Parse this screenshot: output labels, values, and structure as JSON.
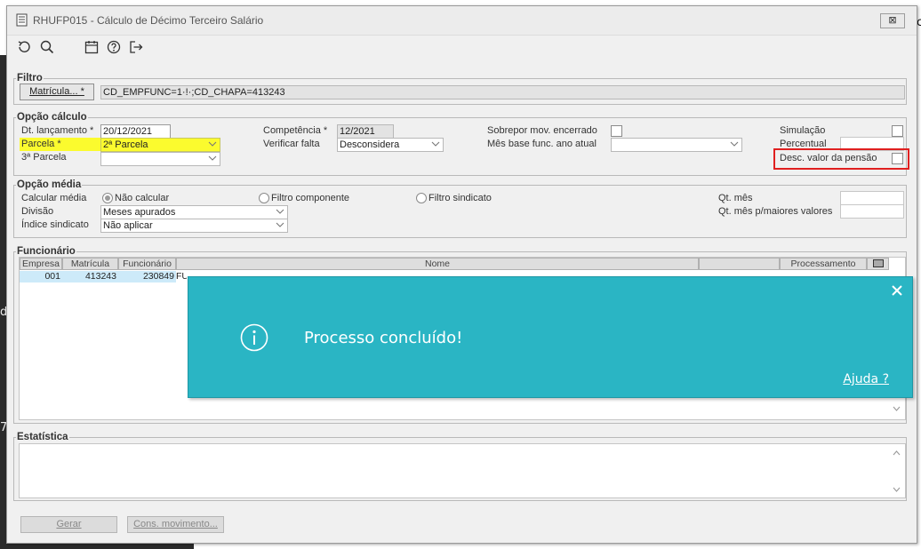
{
  "background": {
    "left_letter_1": "d",
    "left_letter_2": "7",
    "right_letter": "c"
  },
  "window": {
    "title": "RHUFP015 - Cálculo de Décimo Terceiro Salário",
    "close_glyph": "⊠",
    "toolbar_icons": [
      "undo-icon",
      "search-icon",
      "calendar-icon",
      "help-icon",
      "exit-icon"
    ]
  },
  "filtro": {
    "legend": "Filtro",
    "matricula_button": "Matrícula... *",
    "filter_value": "CD_EMPFUNC=1·!·;CD_CHAPA=413243"
  },
  "opcao_calculo": {
    "legend": "Opção cálculo",
    "dt_lancamento_label": "Dt. lançamento *",
    "dt_lancamento_value": "20/12/2021",
    "parcela_label": "Parcela *",
    "parcela_value": "2ª Parcela",
    "terceira_parcela_label": "3ª Parcela",
    "terceira_parcela_value": "",
    "competencia_label": "Competência *",
    "competencia_value": "12/2021",
    "verificar_falta_label": "Verificar falta",
    "verificar_falta_value": "Desconsidera",
    "sobrepor_label": "Sobrepor mov. encerrado",
    "mes_base_label": "Mês base func. ano atual",
    "mes_base_value": "",
    "simulacao_label": "Simulação",
    "percentual_label": "Percentual",
    "percentual_value": "",
    "desc_pensao_label": "Desc. valor da pensão"
  },
  "opcao_media": {
    "legend": "Opção média",
    "calcular_media_label": "Calcular média",
    "radio_nao_calcular": "Não calcular",
    "radio_filtro_componente": "Filtro componente",
    "radio_filtro_sindicato": "Filtro sindicato",
    "divisao_label": "Divisão",
    "divisao_value": "Meses apurados",
    "indice_sindicato_label": "Índice sindicato",
    "indice_sindicato_value": "Não aplicar",
    "qt_mes_label": "Qt. mês",
    "qt_mes_value": "",
    "qt_mes_maiores_label": "Qt. mês p/maiores valores",
    "qt_mes_maiores_value": ""
  },
  "funcionario": {
    "legend": "Funcionário",
    "columns": [
      "Empresa",
      "Matrícula",
      "Funcionário",
      "Nome",
      "",
      "Processamento"
    ],
    "row": {
      "empresa": "001",
      "matricula": "413243",
      "funcionario": "230849",
      "nome_partial": "FU"
    }
  },
  "estatistica": {
    "legend": "Estatística",
    "value": ""
  },
  "buttons": {
    "gerar": "Gerar",
    "cons_movimento": "Cons. movimento..."
  },
  "toast": {
    "message": "Processo concluído!",
    "help_link": "Ajuda ?",
    "color": "#2ab5c4"
  },
  "highlights": {
    "yellow": "#fbfb2e",
    "red": "#e02020"
  }
}
